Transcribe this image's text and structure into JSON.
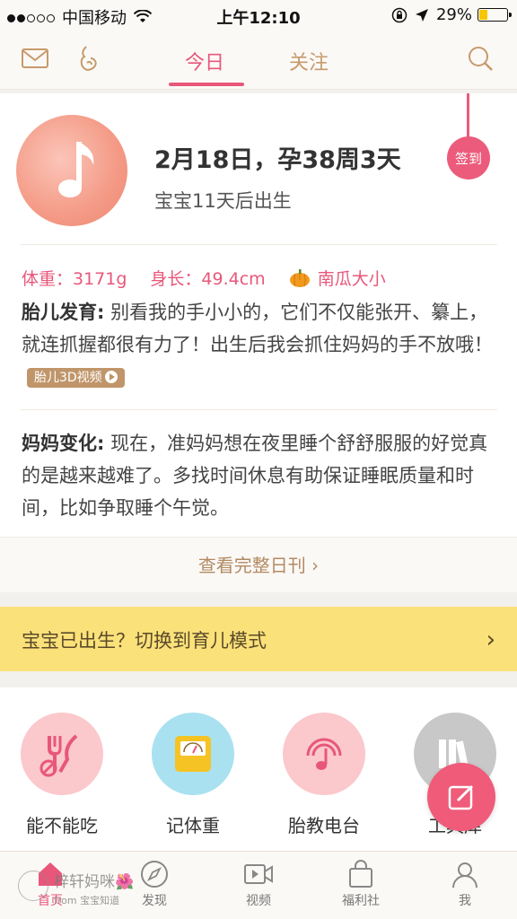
{
  "status_bar": {
    "carrier": "中国移动",
    "time": "上午12:10",
    "battery": "29%",
    "battery_level": 0.29
  },
  "header": {
    "tabs": [
      {
        "label": "今日",
        "active": true
      },
      {
        "label": "关注",
        "active": false
      }
    ]
  },
  "daily": {
    "date_line": "2月18日，孕38周3天",
    "due_line": "宝宝11天后出生",
    "checkin_label": "签到",
    "weight": "体重：3171g",
    "length": "身长：49.4cm",
    "size_compare": "南瓜大小",
    "fetal": {
      "title": "胎儿发育:",
      "text": "别看我的手小小的，它们不仅能张开、纂上，就连抓握都很有力了！出生后我会抓住妈妈的手不放哦！",
      "video_button": "胎儿3D视频"
    },
    "mom": {
      "title": "妈妈变化:",
      "text": "现在，准妈妈想在夜里睡个舒舒服服的好觉真的是越来越难了。多找时间休息有助保证睡眠质量和时间，比如争取睡个午觉。"
    },
    "full_link": "查看完整日刊 ›"
  },
  "banner": {
    "text": "宝宝已出生？切换到育儿模式",
    "chevron": "›"
  },
  "tools": [
    {
      "label": "能不能吃",
      "color": "#fbc8cc",
      "icon": "fork-knife-icon"
    },
    {
      "label": "记体重",
      "color": "#a9e1f0",
      "icon": "scale-icon"
    },
    {
      "label": "胎教电台",
      "color": "#fbc8cc",
      "icon": "radio-icon"
    },
    {
      "label": "工具库",
      "color": "#c8c8c8",
      "icon": "books-icon"
    }
  ],
  "tabbar": {
    "items": [
      {
        "label": "首页",
        "active": true
      },
      {
        "label": "发现",
        "active": false
      },
      {
        "label": "视频",
        "active": false
      },
      {
        "label": "福利社",
        "active": false
      },
      {
        "label": "我",
        "active": false
      }
    ]
  },
  "watermark": {
    "main": "梓轩妈咪🌺",
    "sub": "from 宝宝知道"
  },
  "colors": {
    "accent": "#e8577a",
    "gold": "#c69a6c",
    "banner": "#fbe17a"
  }
}
